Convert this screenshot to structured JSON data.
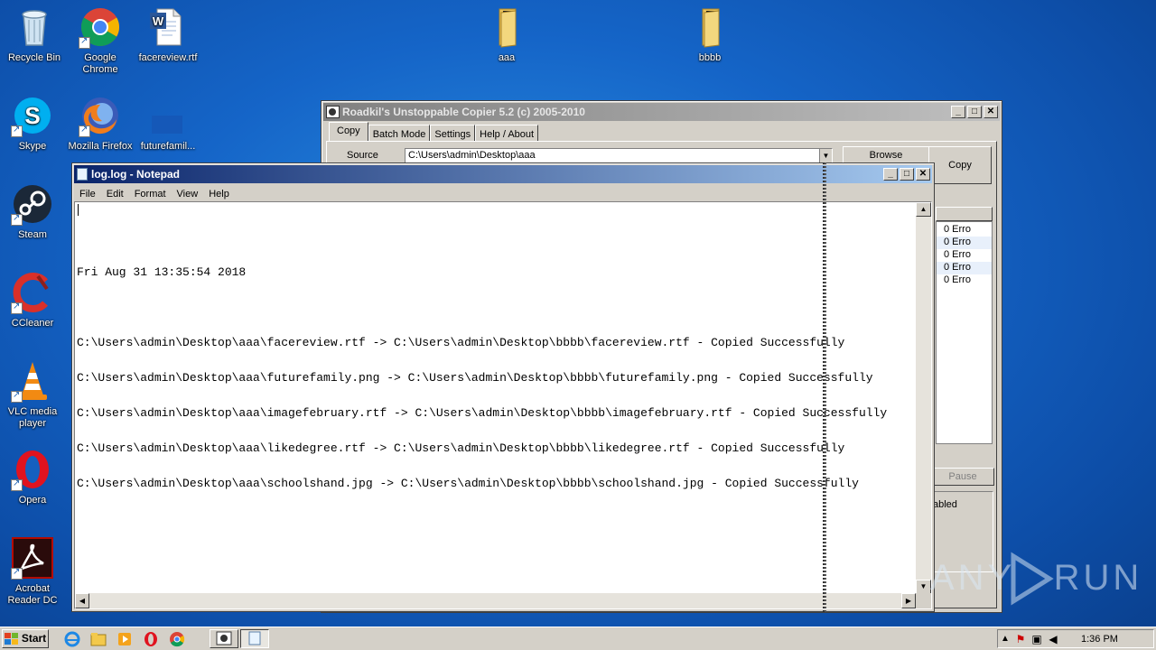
{
  "desktop": {
    "icons": [
      {
        "label": "Recycle Bin"
      },
      {
        "label": "Google Chrome"
      },
      {
        "label": "facereview.rtf"
      },
      {
        "label": "aaa"
      },
      {
        "label": "bbbb"
      },
      {
        "label": "Skype"
      },
      {
        "label": "Mozilla Firefox"
      },
      {
        "label": "futurefamil..."
      },
      {
        "label": "Steam"
      },
      {
        "label": "CCleaner"
      },
      {
        "label": "VLC media player"
      },
      {
        "label": "Opera"
      },
      {
        "label": "Acrobat Reader DC"
      }
    ]
  },
  "copier": {
    "title": "Roadkil's Unstoppable Copier 5.2 (c) 2005-2010",
    "tabs": [
      "Copy",
      "Batch Mode",
      "Settings",
      "Help / About"
    ],
    "source_label": "Source",
    "source_value": "C:\\Users\\admin\\Desktop\\aaa",
    "browse_label": "Browse",
    "copy_label": "Copy",
    "errors": [
      "0 Erro",
      "0 Erro",
      "0 Erro",
      "0 Erro",
      "0 Erro"
    ],
    "pause_label": "Pause",
    "status_fragment": "abled"
  },
  "notepad": {
    "title": "log.log - Notepad",
    "menu": [
      "File",
      "Edit",
      "Format",
      "View",
      "Help"
    ],
    "lines": [
      "",
      "Fri Aug 31 13:35:54 2018",
      "",
      "C:\\Users\\admin\\Desktop\\aaa\\facereview.rtf -> C:\\Users\\admin\\Desktop\\bbbb\\facereview.rtf - Copied Successfully",
      "C:\\Users\\admin\\Desktop\\aaa\\futurefamily.png -> C:\\Users\\admin\\Desktop\\bbbb\\futurefamily.png - Copied Successfully",
      "C:\\Users\\admin\\Desktop\\aaa\\imagefebruary.rtf -> C:\\Users\\admin\\Desktop\\bbbb\\imagefebruary.rtf - Copied Successfully",
      "C:\\Users\\admin\\Desktop\\aaa\\likedegree.rtf -> C:\\Users\\admin\\Desktop\\bbbb\\likedegree.rtf - Copied Successfully",
      "C:\\Users\\admin\\Desktop\\aaa\\schoolshand.jpg -> C:\\Users\\admin\\Desktop\\bbbb\\schoolshand.jpg - Copied Successfully"
    ]
  },
  "taskbar": {
    "start_label": "Start",
    "clock": "1:36 PM"
  },
  "watermark": "ANY RUN",
  "colors": {
    "active_title": "#0a246a",
    "active_title_end": "#a6caf0",
    "inactive_title": "#808080",
    "inactive_title_end": "#c0c0c0"
  }
}
